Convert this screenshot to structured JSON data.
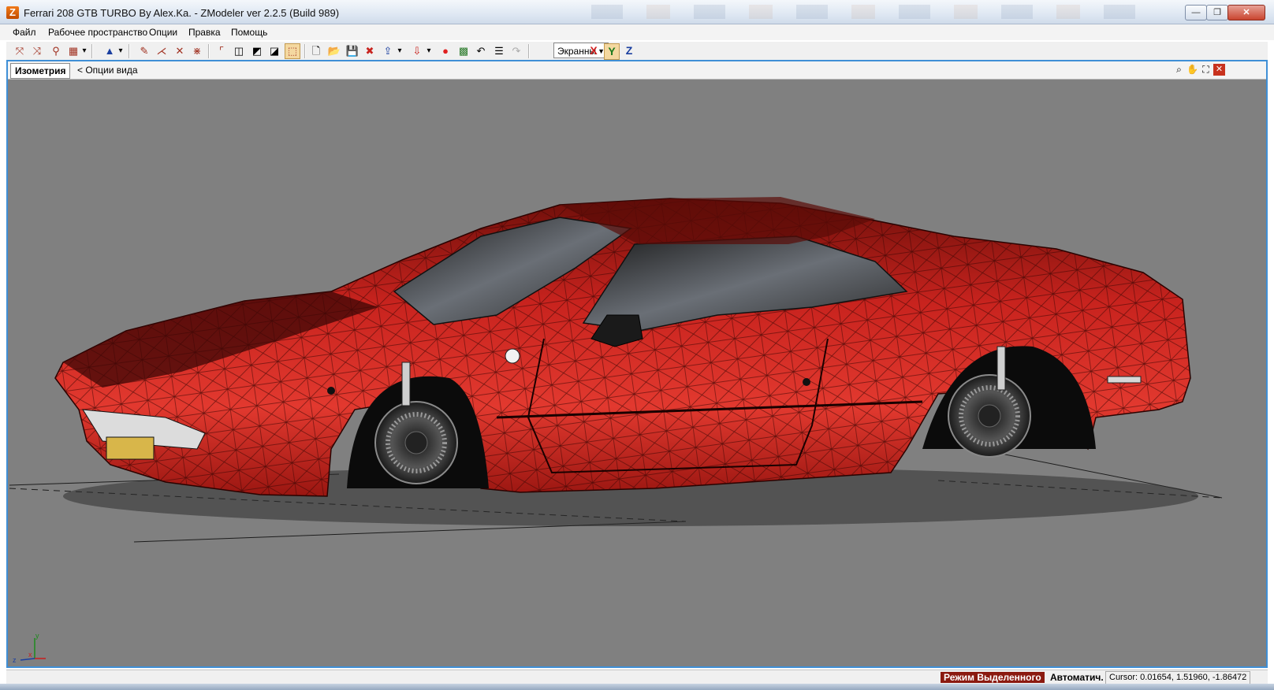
{
  "window": {
    "title": "Ferrari 208 GTB TURBO By Alex.Ka. - ZModeler ver 2.2.5 (Build 989)",
    "app_icon_letter": "Z",
    "controls": {
      "minimize": "—",
      "maximize": "❐",
      "close": "✕"
    }
  },
  "menu": {
    "items": [
      "Файл",
      "Рабочее пространство",
      "Опции",
      "Правка",
      "Помощь"
    ]
  },
  "toolbar": {
    "icons": [
      {
        "name": "select-vertex-icon",
        "glyph": "⤧"
      },
      {
        "name": "select-edge-icon",
        "glyph": "⤨"
      },
      {
        "name": "select-bone-icon",
        "glyph": "⚲"
      },
      {
        "name": "select-object-icon",
        "glyph": "▦"
      },
      {
        "name": "dropdown-arrow-icon",
        "glyph": "▾"
      },
      {
        "name": "cone-primitive-icon",
        "glyph": "▲"
      },
      {
        "name": "dropdown-arrow-icon",
        "glyph": "▾"
      },
      {
        "name": "paint-tool-icon",
        "glyph": "✎"
      },
      {
        "name": "weld-icon",
        "glyph": "⋌"
      },
      {
        "name": "cut-edge-icon",
        "glyph": "✕"
      },
      {
        "name": "split-icon",
        "glyph": "⋇"
      },
      {
        "name": "snap-icon",
        "glyph": "⌜"
      },
      {
        "name": "box-icon",
        "glyph": "◫"
      },
      {
        "name": "cube-icon",
        "glyph": "◩"
      },
      {
        "name": "cube-wire-icon",
        "glyph": "◪"
      },
      {
        "name": "cube-shaded-icon",
        "glyph": "⬚"
      },
      {
        "name": "new-file-icon",
        "glyph": "🗋"
      },
      {
        "name": "open-file-icon",
        "glyph": "📂"
      },
      {
        "name": "save-icon",
        "glyph": "💾"
      },
      {
        "name": "delete-icon",
        "glyph": "✖"
      },
      {
        "name": "import-icon",
        "glyph": "⇪"
      },
      {
        "name": "dropdown-arrow-icon",
        "glyph": "▾"
      },
      {
        "name": "export-icon",
        "glyph": "⇩"
      },
      {
        "name": "dropdown-arrow-icon",
        "glyph": "▾"
      },
      {
        "name": "material-sphere-icon",
        "glyph": "●"
      },
      {
        "name": "texture-icon",
        "glyph": "▩"
      },
      {
        "name": "undo-icon",
        "glyph": "↶"
      },
      {
        "name": "properties-icon",
        "glyph": "☰"
      },
      {
        "name": "redo-icon",
        "glyph": "↷"
      }
    ],
    "coord_mode": "Экранны",
    "axes": [
      "X",
      "Y",
      "Z"
    ]
  },
  "viewport": {
    "view_name": "Изометрия",
    "options_label": "<  Опции вида",
    "tool_icons": [
      "zoom-icon",
      "pan-icon",
      "fit-view-icon",
      "close-view-icon"
    ],
    "gizmo": {
      "y": "y",
      "z": "z",
      "x": "x"
    }
  },
  "status": {
    "mode": "Режим Выделенного",
    "auto": "Автоматич.",
    "cursor": "Cursor: 0.01654, 1.51960, -1.86472"
  },
  "colors": {
    "viewport_bg": "#808080",
    "car_body": "#c8231e",
    "accent_frame": "#3f8fd6",
    "status_mode_bg": "#8b1a10"
  }
}
